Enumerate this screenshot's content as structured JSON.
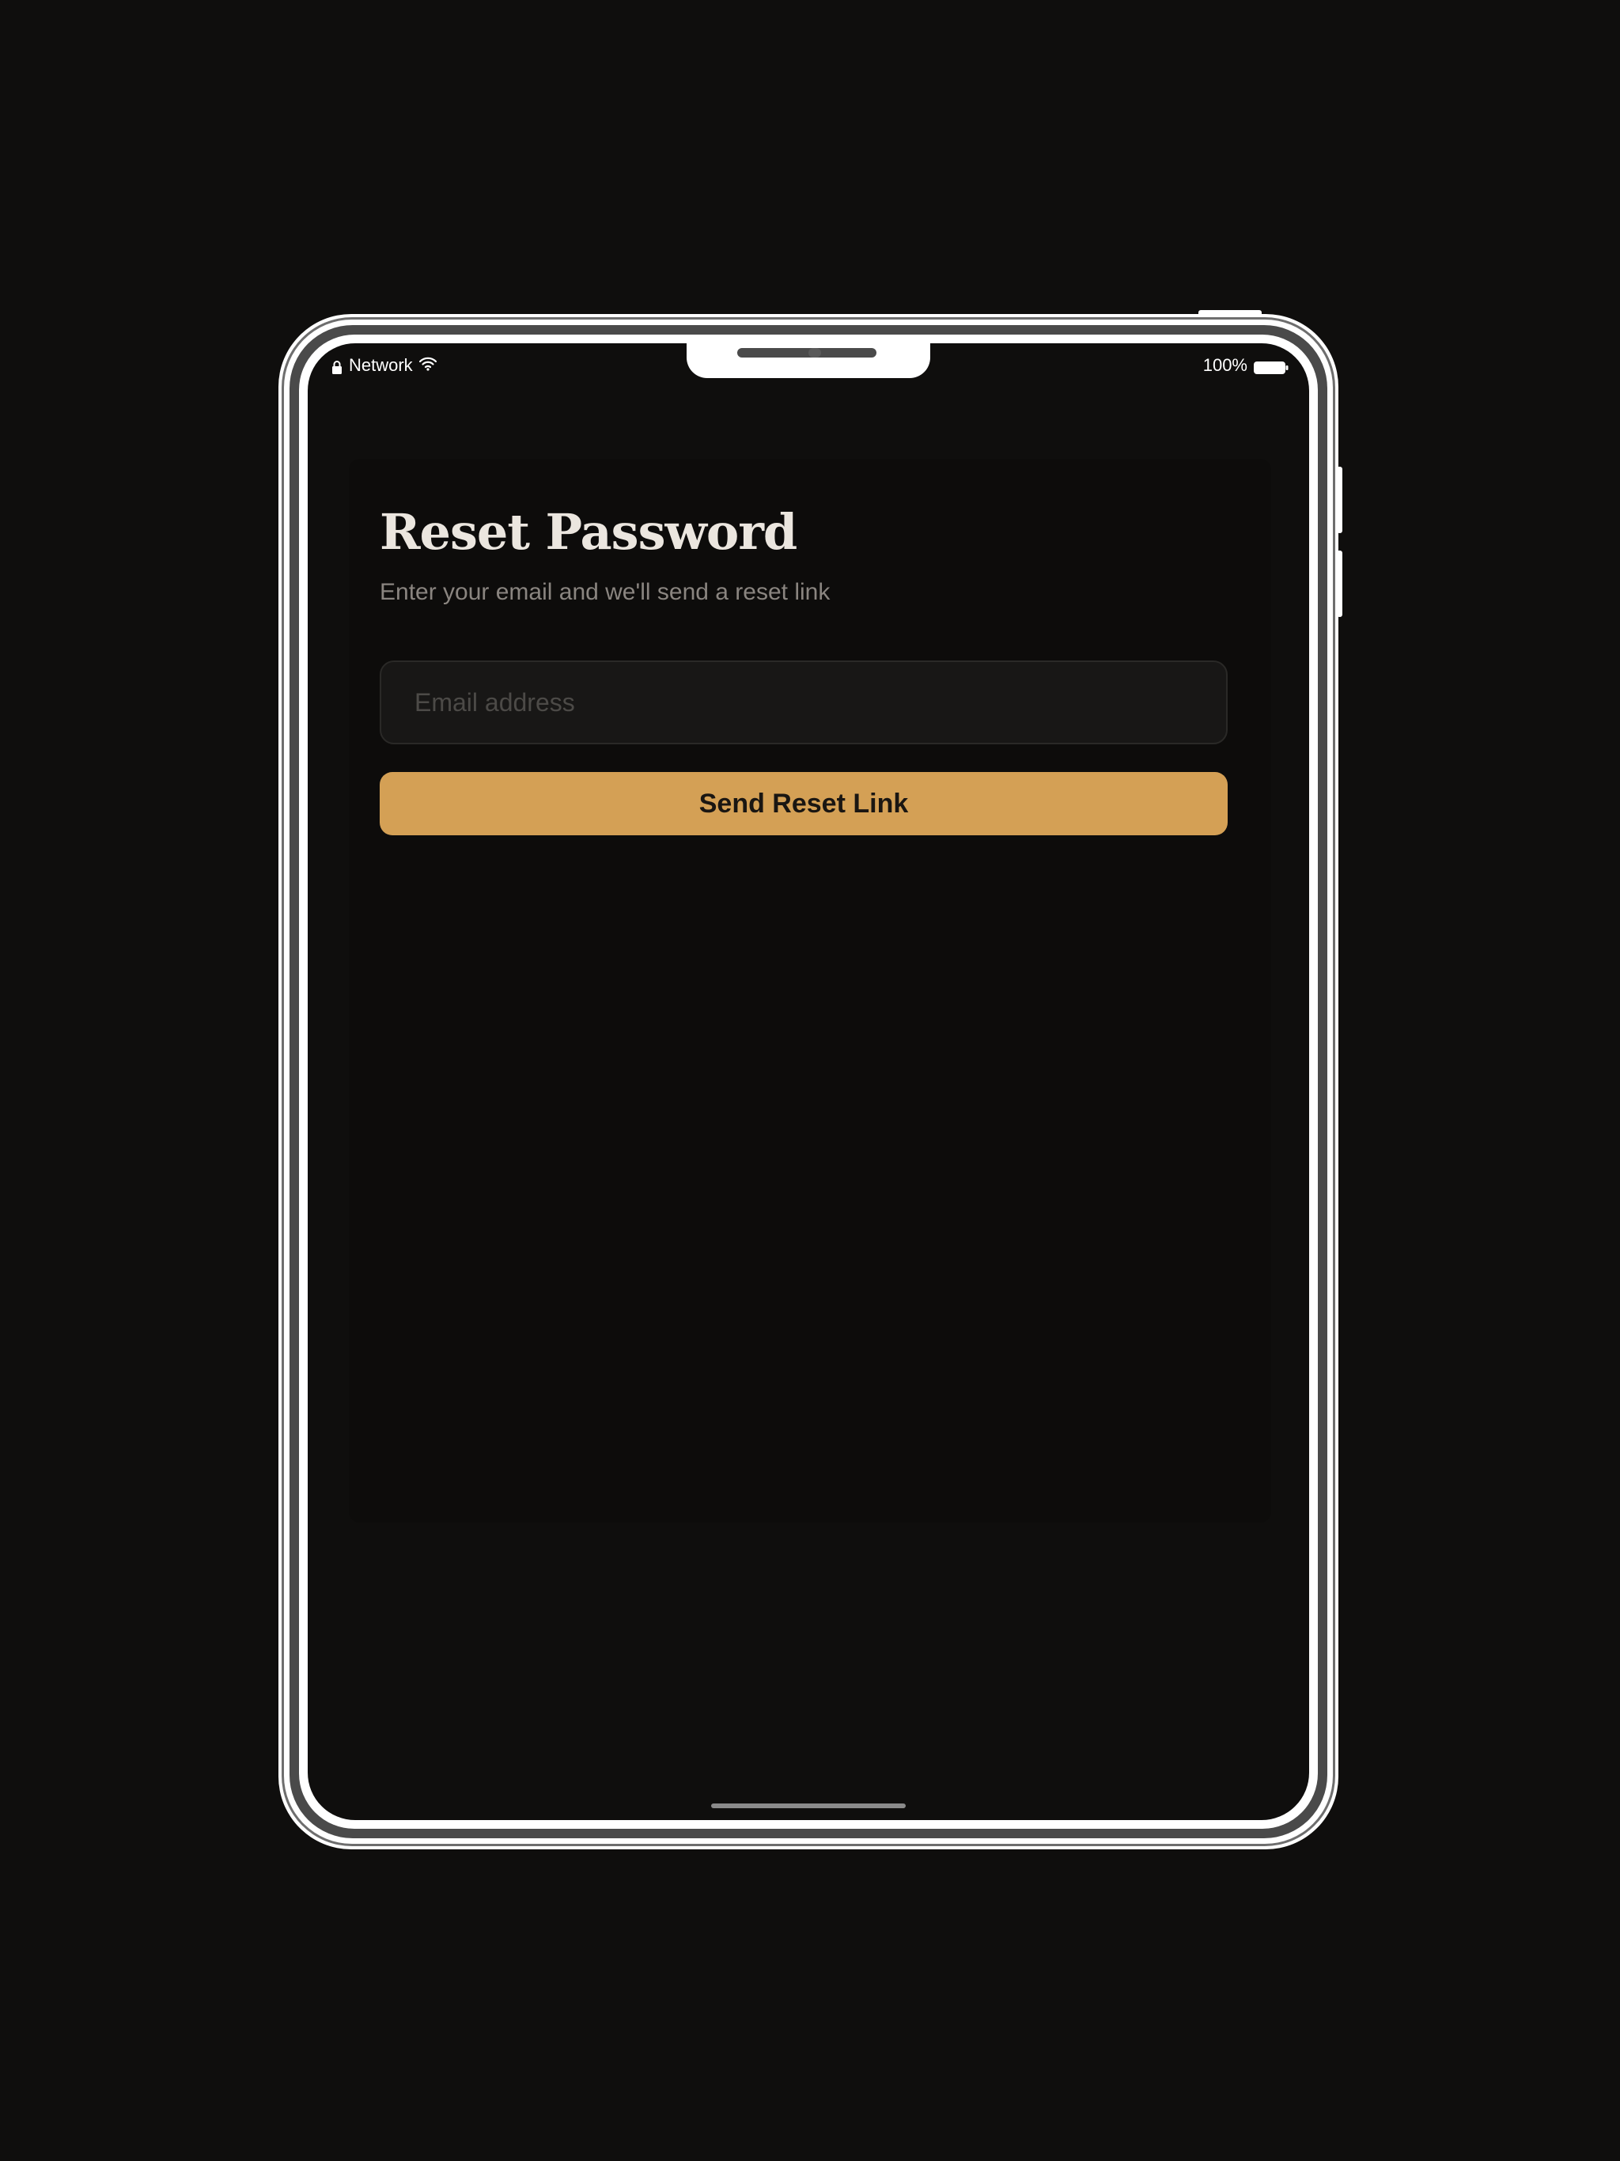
{
  "status_bar": {
    "network_label": "Network",
    "battery_label": "100%"
  },
  "screen": {
    "title": "Reset Password",
    "subtitle": "Enter your email and we'll send a reset link",
    "email_placeholder": "Email address",
    "email_value": "",
    "submit_label": "Send Reset Link"
  },
  "colors": {
    "background": "#0f0e0d",
    "accent": "#d4a055",
    "title_text": "#ebe6df",
    "subtitle_text": "#8a8580"
  },
  "icons": [
    "lock-icon",
    "wifi-icon",
    "battery-icon"
  ]
}
